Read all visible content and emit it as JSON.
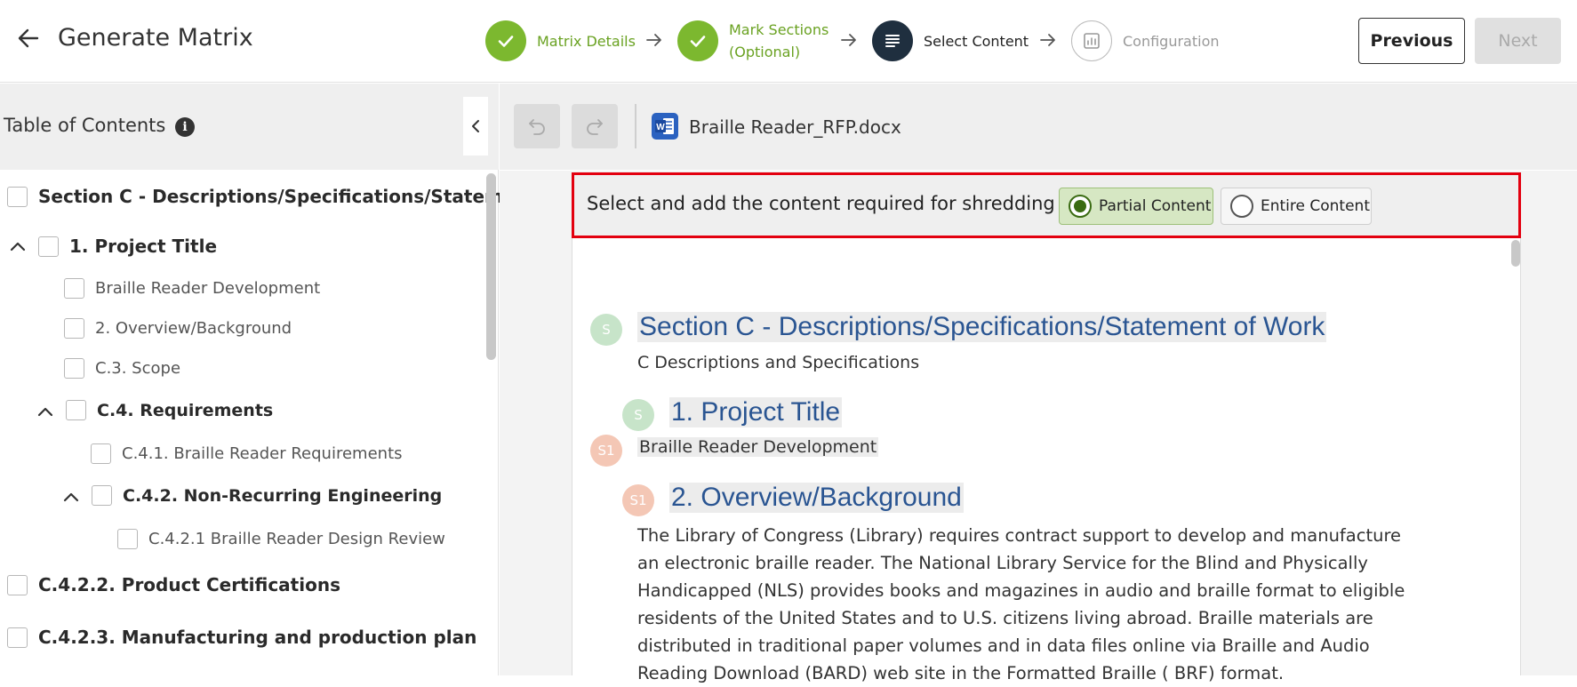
{
  "header": {
    "title": "Generate Matrix",
    "steps": [
      {
        "label": "Matrix Details",
        "state": "done"
      },
      {
        "label": "Mark Sections",
        "label_line2": "(Optional)",
        "state": "done"
      },
      {
        "label": "Select Content",
        "state": "active"
      },
      {
        "label": "Configuration",
        "state": "pending"
      }
    ],
    "previous_label": "Previous",
    "next_label": "Next"
  },
  "toc": {
    "title": "Table of Contents",
    "info_glyph": "i",
    "items": [
      {
        "label": "Section C - Descriptions/Specifications/Stateme…",
        "style": "bold"
      },
      {
        "label": "1. Project Title",
        "style": "bold",
        "expanded": true
      },
      {
        "label": "Braille Reader Development",
        "style": "normal"
      },
      {
        "label": "2. Overview/Background",
        "style": "normal"
      },
      {
        "label": "C.3. Scope",
        "style": "normal"
      },
      {
        "label": "C.4. Requirements",
        "style": "bold",
        "expanded": true
      },
      {
        "label": "C.4.1. Braille Reader Requirements",
        "style": "normal"
      },
      {
        "label": "C.4.2. Non-Recurring Engineering",
        "style": "bold",
        "expanded": true
      },
      {
        "label": "C.4.2.1 Braille Reader Design Review",
        "style": "normal"
      },
      {
        "label": "C.4.2.2. Product Certifications",
        "style": "bold"
      },
      {
        "label": "C.4.2.3. Manufacturing and production plan",
        "style": "bold"
      }
    ]
  },
  "toolbar": {
    "filename": "Braille Reader_RFP.docx",
    "file_type_icon": "word-doc-icon"
  },
  "shredding": {
    "label": "Select and add the content required for shredding",
    "options": [
      {
        "label": "Partial Content",
        "selected": true
      },
      {
        "label": "Entire Content",
        "selected": false
      }
    ]
  },
  "document": {
    "badges": [
      "S",
      "S",
      "S1",
      "S1"
    ],
    "heading_1": "Section C - Descriptions/Specifications/Statement of Work",
    "subtext_1": "C Descriptions and Specifications",
    "heading_2": "1. Project Title",
    "subtext_2": "Braille Reader Development",
    "heading_3": "2. Overview/Background",
    "paragraph": "The Library of Congress (Library) requires contract support to develop and manufacture an electronic braille reader. The National Library Service for the Blind and Physically Handicapped (NLS) provides books and magazines in audio and braille format to eligible residents of the United States and to U.S. citizens living abroad. Braille materials are distributed in traditional paper volumes and in data files online via Braille and Audio Reading Download (BARD) web site in the Formatted Braille ( BRF) format."
  },
  "colors": {
    "step_done": "#7cb82f",
    "step_active": "#1f2f3f",
    "highlight_border": "#e3000f",
    "selected_option_bg": "#d6e7c3",
    "heading_blue": "#2a5592",
    "badge_s": "#c7e4c9",
    "badge_s1": "#f4c7b5"
  }
}
